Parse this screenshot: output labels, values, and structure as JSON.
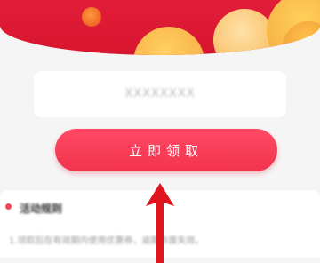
{
  "banner": {
    "colors": {
      "background": "#e11d39",
      "coin_gold": "#f5a33c"
    }
  },
  "code_card": {
    "code_text": "XXXXXXXX"
  },
  "claim_button": {
    "label": "立即领取",
    "color": "#f2334e"
  },
  "rules_section": {
    "title": "活动规则",
    "description": "1.领取后在有效期内使用优惠券，逾期作废失效。"
  },
  "annotation": {
    "icon": "red-arrow-up-icon",
    "color": "#e0141e"
  }
}
